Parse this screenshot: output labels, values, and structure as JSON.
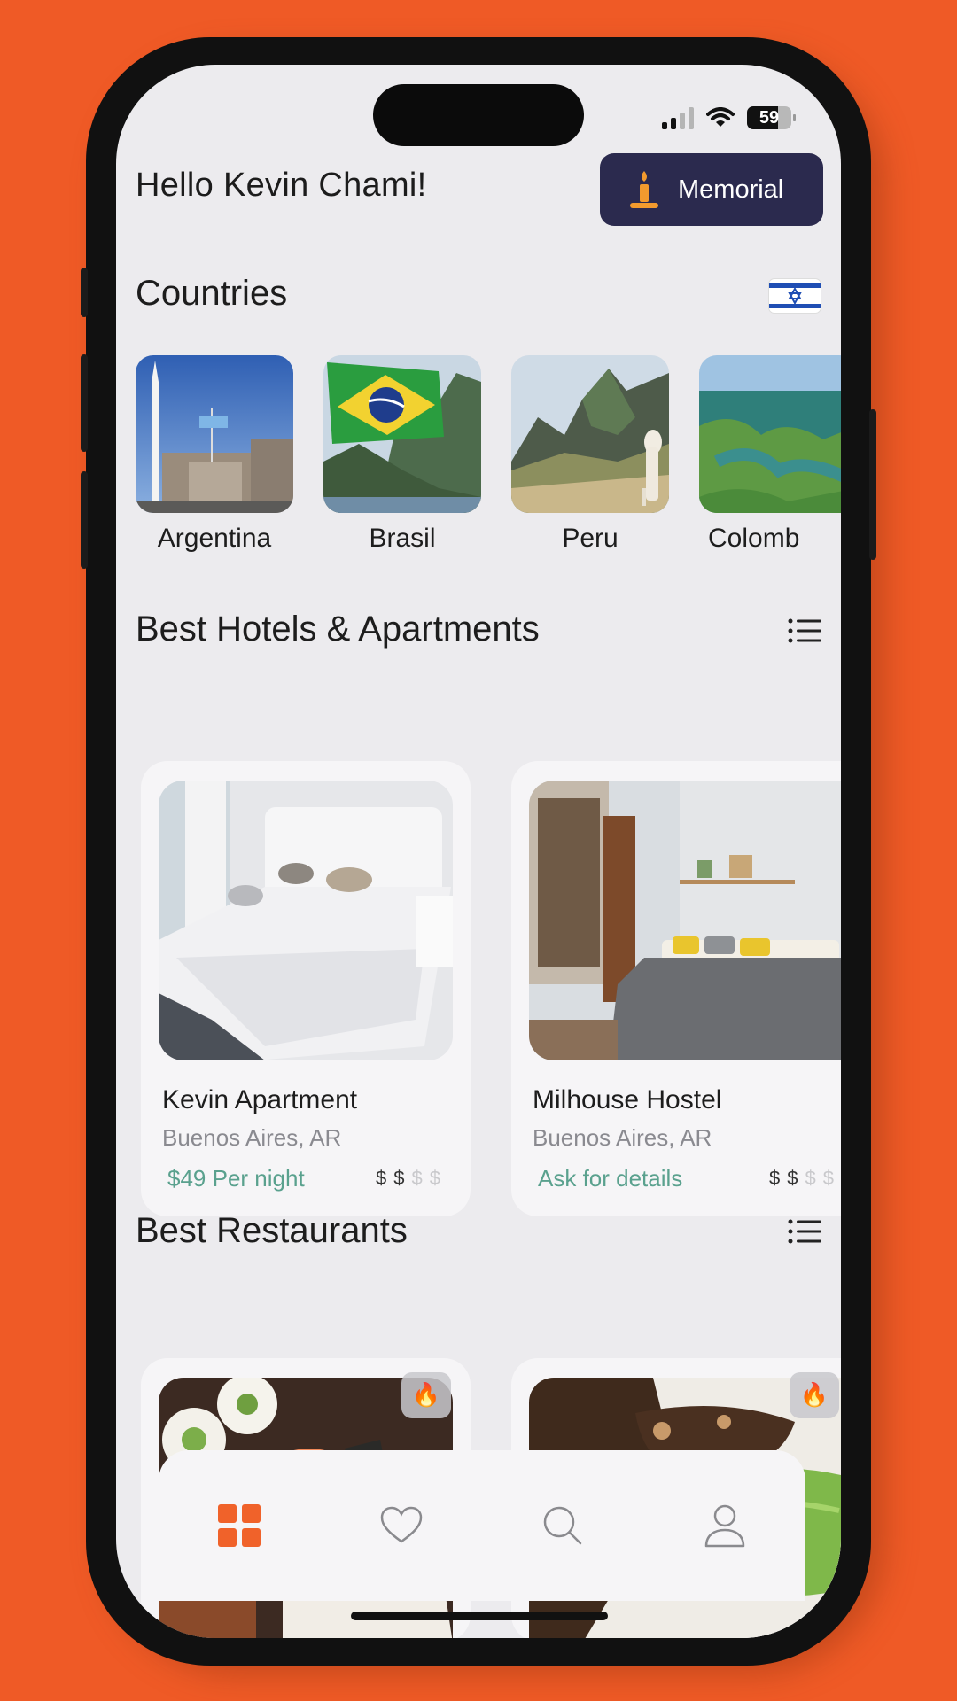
{
  "status_bar": {
    "battery": "59"
  },
  "header": {
    "greeting": "Hello Kevin Chami!",
    "memorial_label": "Memorial"
  },
  "countries": {
    "title": "Countries",
    "items": [
      {
        "name": "Argentina"
      },
      {
        "name": "Brasil"
      },
      {
        "name": "Peru"
      },
      {
        "name": "Colomb"
      }
    ]
  },
  "hotels": {
    "title": "Best Hotels & Apartments",
    "items": [
      {
        "title": "Kevin Apartment",
        "location": "Buenos Aires, AR",
        "price": "$49 Per night",
        "price_level": 2,
        "price_max": 4
      },
      {
        "title": "Milhouse Hostel",
        "location": "Buenos Aires, AR",
        "price": "Ask for details",
        "price_level": 2,
        "price_max": 4
      }
    ]
  },
  "restaurants": {
    "title": "Best Restaurants"
  },
  "tabbar": {
    "items": [
      {
        "icon": "grid-icon",
        "active": true
      },
      {
        "icon": "heart-icon",
        "active": false
      },
      {
        "icon": "search-icon",
        "active": false
      },
      {
        "icon": "profile-icon",
        "active": false
      }
    ]
  },
  "colors": {
    "background": "#ef5a26",
    "accent": "#f0622a",
    "memorial_bg": "#2b2a4e",
    "price_text": "#5aa18e"
  }
}
